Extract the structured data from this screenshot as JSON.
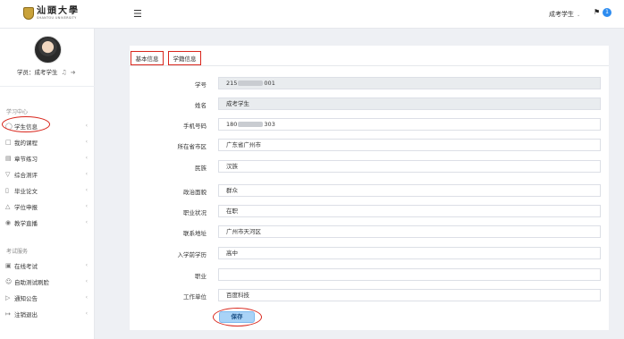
{
  "header": {
    "logo_cn": "汕頭大學",
    "logo_en": "SHANTOU UNIVERSITY",
    "menu_icon": "hamburger-icon",
    "user_name": "成考学生",
    "notification_count": "1"
  },
  "sidebar": {
    "student_label": "学员：成考学生",
    "section_study": "学习中心",
    "study_items": [
      {
        "label": "学生信息",
        "icon": "user-icon"
      },
      {
        "label": "我的课程",
        "icon": "book-icon"
      },
      {
        "label": "章节练习",
        "icon": "document-icon"
      },
      {
        "label": "综合测评",
        "icon": "filter-icon"
      },
      {
        "label": "毕业论文",
        "icon": "paper-icon"
      },
      {
        "label": "学位申报",
        "icon": "cap-icon"
      },
      {
        "label": "教学直播",
        "icon": "live-icon"
      }
    ],
    "section_exam": "考试服务",
    "exam_items": [
      {
        "label": "在线考试",
        "icon": "monitor-icon"
      },
      {
        "label": "自助测试刷脸",
        "icon": "face-icon"
      },
      {
        "label": "通知公告",
        "icon": "megaphone-icon"
      },
      {
        "label": "注销退出",
        "icon": "logout-icon"
      }
    ]
  },
  "tabs": [
    {
      "label": "基本信息",
      "active": true
    },
    {
      "label": "学籍信息",
      "active": false
    }
  ],
  "form": {
    "student_id": {
      "label": "学号",
      "prefix": "215",
      "suffix": "001"
    },
    "name": {
      "label": "姓名",
      "value": "成考学生"
    },
    "phone": {
      "label": "手机号码",
      "prefix": "180",
      "suffix": "303"
    },
    "province": {
      "label": "所在省市区",
      "value": "广东省广州市"
    },
    "ethnicity": {
      "label": "民族",
      "value": "汉族"
    },
    "politics": {
      "label": "政治面貌",
      "value": "群众"
    },
    "job_status": {
      "label": "职业状况",
      "value": "在职"
    },
    "address": {
      "label": "联系地址",
      "value": "广州市天河区"
    },
    "education": {
      "label": "入学前学历",
      "value": "高中"
    },
    "occupation": {
      "label": "职业",
      "value": ""
    },
    "employer": {
      "label": "工作单位",
      "value": "百度科技"
    }
  },
  "save_label": "保存",
  "colors": {
    "highlight": "#d9261c",
    "accent": "#2d8cf0",
    "save_bg": "#a9d3f7"
  }
}
